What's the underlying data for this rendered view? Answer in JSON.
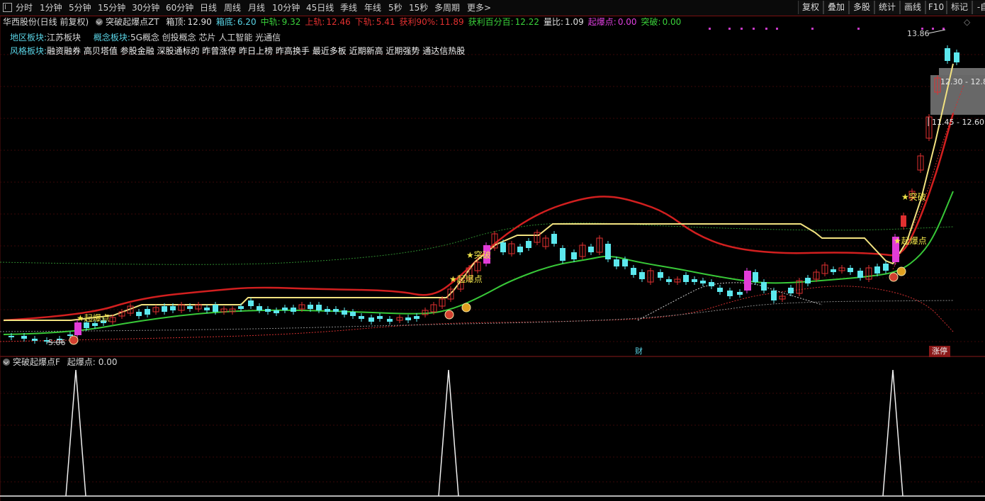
{
  "toolbar": {
    "periods": [
      "分时",
      "1分钟",
      "5分钟",
      "15分钟",
      "30分钟",
      "60分钟",
      "日线",
      "周线",
      "月线",
      "10分钟",
      "45日线",
      "季线",
      "年线",
      "5秒",
      "15秒",
      "多周期",
      "更多>"
    ],
    "right_buttons": [
      "复权",
      "叠加",
      "多股",
      "统计",
      "画线",
      "F10",
      "标记",
      "-自"
    ]
  },
  "header": {
    "stock": "华西股份(日线 前复权)",
    "indicator": "突破起爆点ZT",
    "items": [
      {
        "label": "箱顶:",
        "value": "12.90",
        "color": "#e0e0e0"
      },
      {
        "label": "箱底:",
        "value": "6.20",
        "color": "#5ad4e6"
      },
      {
        "label": "中轨:",
        "value": "9.32",
        "color": "#3ad23a"
      },
      {
        "label": "上轨:",
        "value": "12.46",
        "color": "#e23030"
      },
      {
        "label": "下轨:",
        "value": "5.41",
        "color": "#e23030"
      },
      {
        "label": "获利90%:",
        "value": "11.89",
        "color": "#e23030"
      },
      {
        "label": "获利百分百:",
        "value": "12.22",
        "color": "#3ad23a"
      },
      {
        "label": "量比:",
        "value": "1.09",
        "color": "#e0e0e0"
      },
      {
        "label": "起爆点:",
        "value": "0.00",
        "color": "#e040e0"
      },
      {
        "label": "突破:",
        "value": "0.00",
        "color": "#3ad23a"
      }
    ]
  },
  "blocks": {
    "region_label": "地区板块:",
    "region_value": "江苏板块",
    "concept_label": "概念板块:",
    "concept_value": "5G概念 创投概念 芯片 人工智能 光通信",
    "style_label": "风格板块:",
    "style_value": "融资融券 高贝塔值 参股金融 深股通标的 昨曾涨停 昨日上榜 昨高换手 最近多板 近期新高 近期强势 通达信热股"
  },
  "chart_labels": {
    "high_price": "13.86",
    "low_price": "5.06",
    "range_box_1": "12.30 - 12.8",
    "range_box_2": "11.45 - 12.60",
    "signal_label": "起爆点",
    "breakout_label": "突破",
    "finance_marker": "财",
    "limit_up_marker": "涨停"
  },
  "sub_panel": {
    "title": "突破起爆点F",
    "label": "起爆点:",
    "value": "0.00"
  },
  "chart_data": {
    "type": "candlestick",
    "price_range": [
      5.0,
      14.0
    ],
    "lines": [
      "箱顶",
      "中轨",
      "上轨",
      "下轨",
      "获利90%",
      "获利百分百"
    ],
    "signal_positions": "three 起爆点 spikes in lower panel"
  }
}
